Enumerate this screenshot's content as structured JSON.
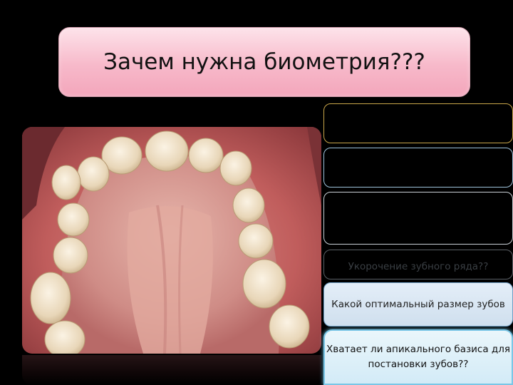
{
  "slide": {
    "title": "Зачем нужна биометрия???"
  },
  "questions": [
    {
      "label": ""
    },
    {
      "label": ""
    },
    {
      "label": ""
    },
    {
      "label": "Укорочение зубного ряда??"
    },
    {
      "label": "Какой оптимальный размер зубов"
    },
    {
      "label": "Хватает ли апикального базиса для постановки зубов??"
    }
  ],
  "colors": {
    "background": "#000000",
    "title_fill": "#f7b9ca",
    "box_gold_border": "#c9a64a",
    "box_blue_border": "#9fc3dc",
    "box_active_border": "#7ac6e6"
  }
}
